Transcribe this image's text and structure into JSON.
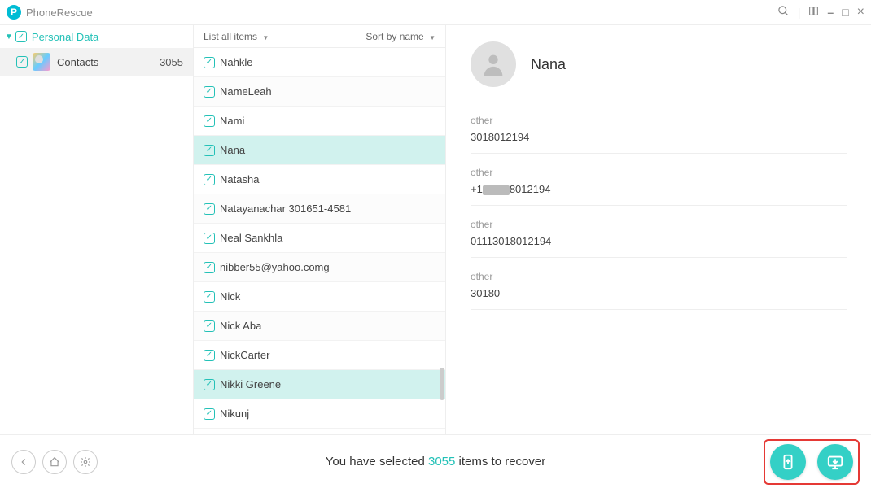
{
  "app": {
    "title": "PhoneRescue"
  },
  "window_controls": {
    "search": "search-icon",
    "tabs": "tabs-icon",
    "min": "–",
    "max": "□",
    "close": "×"
  },
  "sidebar": {
    "root_label": "Personal Data",
    "category": {
      "name": "contacts",
      "label": "Contacts",
      "count": "3055"
    }
  },
  "list_header": {
    "filter_label": "List all items",
    "sort_label": "Sort by name"
  },
  "contacts": [
    {
      "name": "Nahkle",
      "selected": false,
      "alt": false
    },
    {
      "name": "NameLeah",
      "selected": false,
      "alt": true
    },
    {
      "name": "Nami",
      "selected": false,
      "alt": false
    },
    {
      "name": "Nana",
      "selected": true,
      "alt": false
    },
    {
      "name": "Natasha",
      "selected": false,
      "alt": false
    },
    {
      "name": "Natayanachar  301651-4581",
      "selected": false,
      "alt": true
    },
    {
      "name": "Neal  Sankhla",
      "selected": false,
      "alt": false
    },
    {
      "name": "nibber55@yahoo.comg",
      "selected": false,
      "alt": true
    },
    {
      "name": "Nick",
      "selected": false,
      "alt": false
    },
    {
      "name": "Nick  Aba",
      "selected": false,
      "alt": true
    },
    {
      "name": "NickCarter",
      "selected": false,
      "alt": false
    },
    {
      "name": "Nikki  Greene",
      "selected": true,
      "alt": false
    },
    {
      "name": "Nikunj",
      "selected": false,
      "alt": false
    }
  ],
  "detail": {
    "name": "Nana",
    "fields": [
      {
        "label": "other",
        "value": "3018012194",
        "masked": false
      },
      {
        "label": "other",
        "value_prefix": "+1",
        "value_suffix": "8012194",
        "masked": true
      },
      {
        "label": "other",
        "value": "01113018012194",
        "masked": false
      },
      {
        "label": "other",
        "value": "30180",
        "masked": false
      }
    ]
  },
  "footer": {
    "summary_prefix": "You have selected ",
    "summary_count": "3055",
    "summary_suffix": " items to recover"
  }
}
